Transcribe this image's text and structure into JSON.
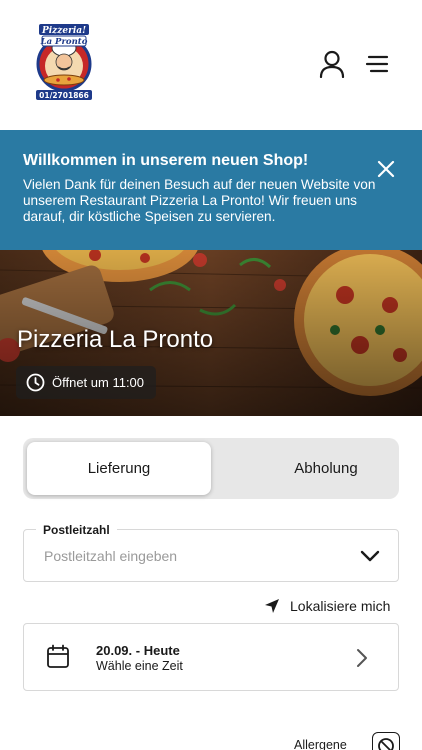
{
  "header": {
    "logo": {
      "text_top": "Pizzeria!",
      "text_mid": "La Pronto",
      "phone": "01/2701866",
      "icon": "pizzeria-logo"
    },
    "user_icon": "user-icon",
    "menu_icon": "hamburger-menu-icon"
  },
  "banner": {
    "title": "Willkommen in unserem neuen Shop!",
    "text": "Vielen Dank für deinen Besuch auf der neuen Website von unserem Restaurant Pizzeria La Pronto! Wir freuen uns darauf, dir köstliche Speisen zu servieren.",
    "close_icon": "close-icon",
    "color": "#2a7aa3"
  },
  "hero": {
    "title": "Pizzeria La Pronto",
    "hours": "Öffnet um 11:00",
    "clock_icon": "clock-icon"
  },
  "order_mode": {
    "options": [
      "Lieferung",
      "Abholung"
    ],
    "selected": "Lieferung"
  },
  "postcode": {
    "label": "Postleitzahl",
    "placeholder": "Postleitzahl eingeben",
    "value": ""
  },
  "locate": {
    "label": "Lokalisiere mich",
    "icon": "location-arrow-icon"
  },
  "time": {
    "date": "20.09. - Heute",
    "hint": "Wähle eine Zeit",
    "icon": "calendar-icon"
  },
  "allergens": {
    "label": "Allergene",
    "icon": "no-allergens-icon"
  }
}
